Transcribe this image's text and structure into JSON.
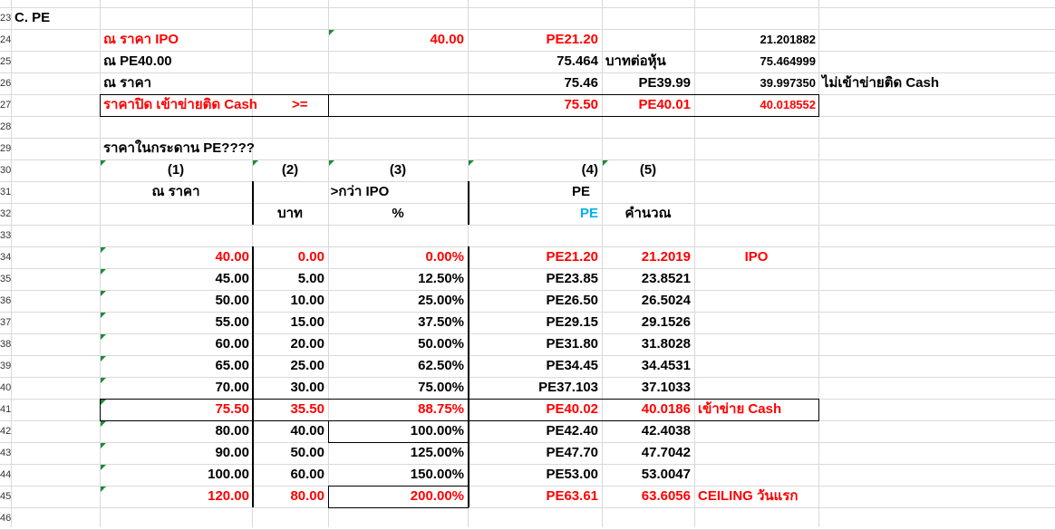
{
  "row_numbers": [
    "23",
    "24",
    "25",
    "26",
    "27",
    "28",
    "29",
    "30",
    "31",
    "32",
    "33",
    "34",
    "35",
    "36",
    "37",
    "38",
    "39",
    "40",
    "41",
    "42",
    "43",
    "44",
    "45",
    "46"
  ],
  "section_title": "C.  PE",
  "top": {
    "r24": {
      "label": "ณ ราคา IPO",
      "price": "40.00",
      "pe": "PE21.20",
      "calc": "21.201882"
    },
    "r25": {
      "label": "ณ PE40.00",
      "price": "75.464",
      "unit": "บาทต่อหุ้น",
      "calc": "75.464999"
    },
    "r26": {
      "label": "ณ ราคา",
      "price": "75.46",
      "pe": "PE39.99",
      "calc": "39.997350",
      "note": "ไม่เข้าข่ายติด Cash"
    },
    "r27": {
      "label": "ราคาปิด เข้าข่ายติด Cash",
      "op": ">=",
      "price": "75.50",
      "pe": "PE40.01",
      "calc": "40.018552"
    }
  },
  "question": "ราคาในกระดาน PE????",
  "headers": {
    "h1": "(1)",
    "h2": "(2)",
    "h3": "(3)",
    "h4": "(4)",
    "h5": "(5)",
    "at_price": "ณ ราคา",
    "over_ipo": ">กว่า IPO",
    "pe": "PE",
    "baht": "บาท",
    "pct": "%",
    "pe_blue": "PE",
    "calc": "คำนวณ"
  },
  "table": [
    {
      "price": "40.00",
      "baht": "0.00",
      "pct": "0.00%",
      "pe": "PE21.20",
      "calc": "21.2019",
      "note": "IPO"
    },
    {
      "price": "45.00",
      "baht": "5.00",
      "pct": "12.50%",
      "pe": "PE23.85",
      "calc": "23.8521",
      "note": ""
    },
    {
      "price": "50.00",
      "baht": "10.00",
      "pct": "25.00%",
      "pe": "PE26.50",
      "calc": "26.5024",
      "note": ""
    },
    {
      "price": "55.00",
      "baht": "15.00",
      "pct": "37.50%",
      "pe": "PE29.15",
      "calc": "29.1526",
      "note": ""
    },
    {
      "price": "60.00",
      "baht": "20.00",
      "pct": "50.00%",
      "pe": "PE31.80",
      "calc": "31.8028",
      "note": ""
    },
    {
      "price": "65.00",
      "baht": "25.00",
      "pct": "62.50%",
      "pe": "PE34.45",
      "calc": "34.4531",
      "note": ""
    },
    {
      "price": "70.00",
      "baht": "30.00",
      "pct": "75.00%",
      "pe": "PE37.103",
      "calc": "37.1033",
      "note": ""
    },
    {
      "price": "75.50",
      "baht": "35.50",
      "pct": "88.75%",
      "pe": "PE40.02",
      "calc": "40.0186",
      "note": "เข้าข่าย Cash"
    },
    {
      "price": "80.00",
      "baht": "40.00",
      "pct": "100.00%",
      "pe": "PE42.40",
      "calc": "42.4038",
      "note": ""
    },
    {
      "price": "90.00",
      "baht": "50.00",
      "pct": "125.00%",
      "pe": "PE47.70",
      "calc": "47.7042",
      "note": ""
    },
    {
      "price": "100.00",
      "baht": "60.00",
      "pct": "150.00%",
      "pe": "PE53.00",
      "calc": "53.0047",
      "note": ""
    },
    {
      "price": "120.00",
      "baht": "80.00",
      "pct": "200.00%",
      "pe": "PE63.61",
      "calc": "63.6056",
      "note": "CEILING วันแรก"
    }
  ],
  "colors": {
    "red": "#ff0000",
    "blue": "#00b0f0",
    "grid": "#d9d9d9",
    "marker": "#1f8a3a"
  }
}
